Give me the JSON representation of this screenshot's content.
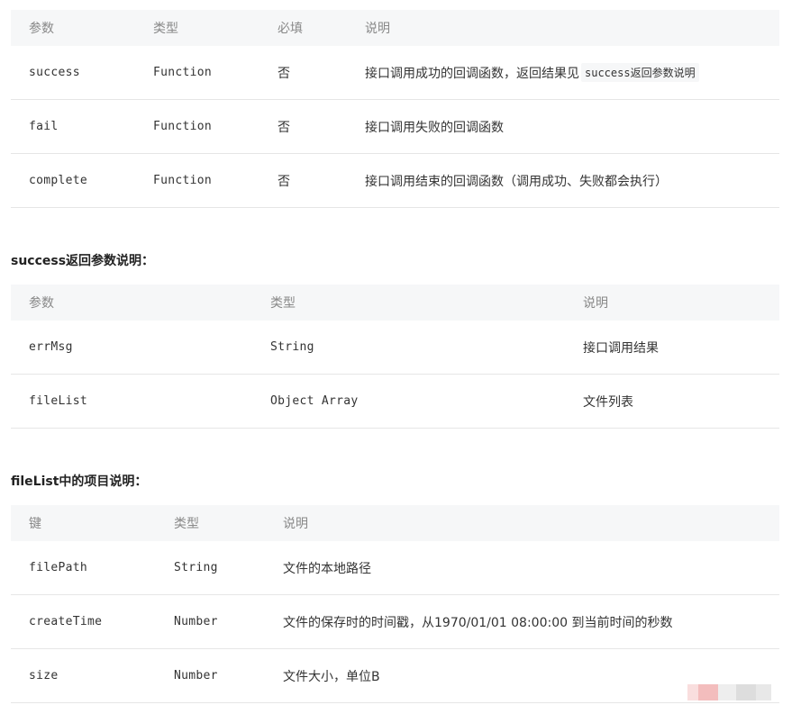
{
  "table1": {
    "headers": [
      "参数",
      "类型",
      "必填",
      "说明"
    ],
    "rows": [
      {
        "name": "success",
        "type": "Function",
        "required": "否",
        "desc": "接口调用成功的回调函数，返回结果见",
        "desc_code": "success返回参数说明"
      },
      {
        "name": "fail",
        "type": "Function",
        "required": "否",
        "desc": "接口调用失败的回调函数"
      },
      {
        "name": "complete",
        "type": "Function",
        "required": "否",
        "desc": "接口调用结束的回调函数（调用成功、失败都会执行）"
      }
    ]
  },
  "section2_title": "success返回参数说明：",
  "table2": {
    "headers": [
      "参数",
      "类型",
      "说明"
    ],
    "rows": [
      {
        "name": "errMsg",
        "type": "String",
        "desc": "接口调用结果"
      },
      {
        "name": "fileList",
        "type": "Object Array",
        "desc": "文件列表"
      }
    ]
  },
  "section3_title": "fileList中的项目说明：",
  "table3": {
    "headers": [
      "键",
      "类型",
      "说明"
    ],
    "rows": [
      {
        "name": "filePath",
        "type": "String",
        "desc": "文件的本地路径"
      },
      {
        "name": "createTime",
        "type": "Number",
        "desc": "文件的保存时的时间戳，从1970/01/01 08:00:00 到当前时间的秒数"
      },
      {
        "name": "size",
        "type": "Number",
        "desc": "文件大小，单位B"
      }
    ]
  },
  "watermark_colors": [
    "#f9dede",
    "#f3bdbd",
    "#eeeeee",
    "#dddddd",
    "#e8e8e8"
  ]
}
